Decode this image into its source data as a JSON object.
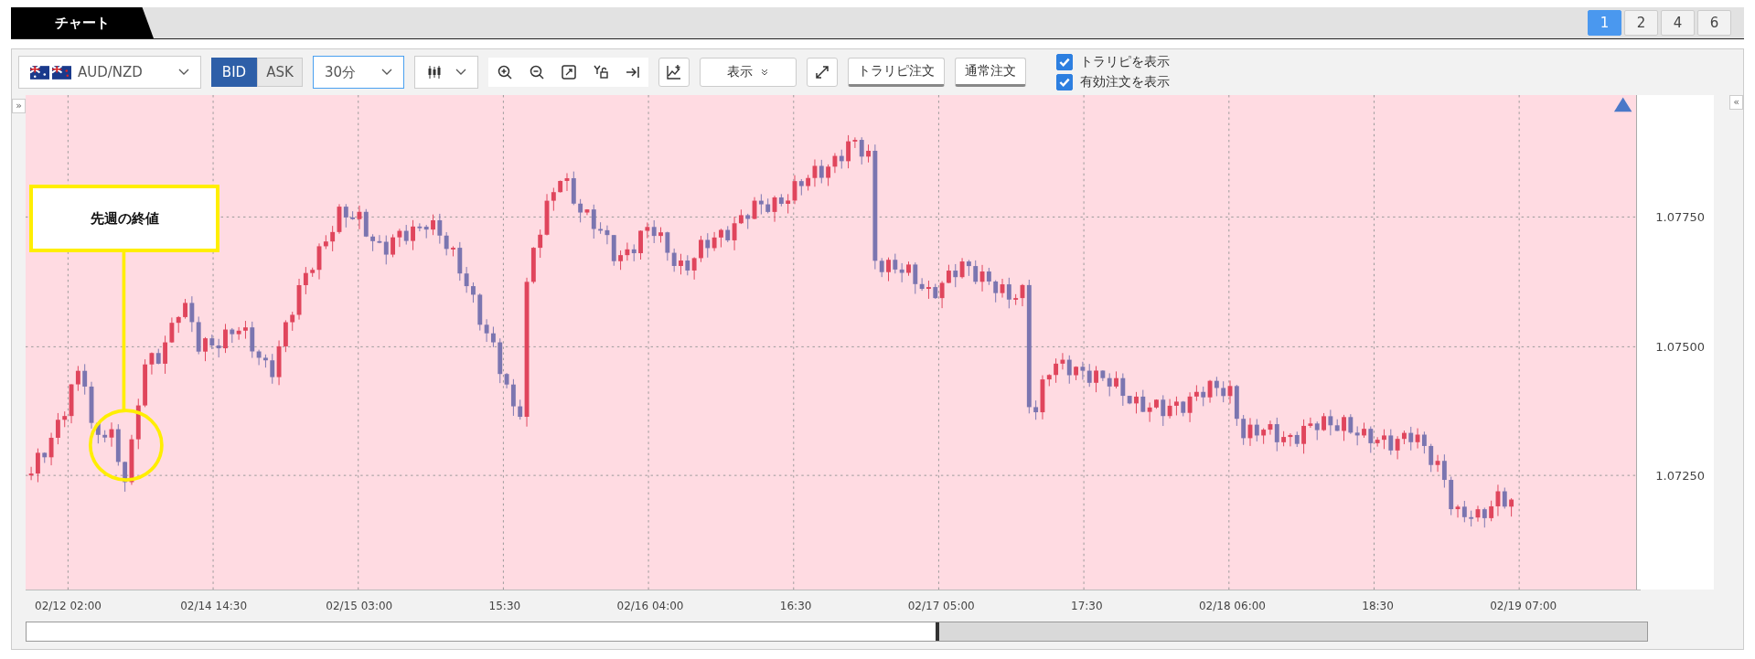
{
  "tabs": [
    {
      "label": "チャート",
      "selected": true
    }
  ],
  "layout_buttons": [
    {
      "label": "1",
      "selected": true
    },
    {
      "label": "2",
      "selected": false
    },
    {
      "label": "4",
      "selected": false
    },
    {
      "label": "6",
      "selected": false
    }
  ],
  "toolbar": {
    "pair": "AUD/NZD",
    "price_side": [
      {
        "label": "BID",
        "selected": true
      },
      {
        "label": "ASK",
        "selected": false
      }
    ],
    "timeframe": "30分",
    "display_menu": "表示",
    "order_buttons": [
      "トラリピ注文",
      "通常注文"
    ],
    "options": [
      {
        "label": "トラリピを表示",
        "checked": true
      },
      {
        "label": "有効注文を表示",
        "checked": true
      }
    ]
  },
  "chart": {
    "collapse_left": "»",
    "collapse_right": "«",
    "annotation": "先週の終値",
    "y_axis_labels": [
      "1.07750",
      "1.07500",
      "1.07250"
    ],
    "x_axis_labels": [
      "02/12 02:00",
      "02/14 14:30",
      "02/15 03:00",
      "15:30",
      "02/16 04:00",
      "16:30",
      "02/17 05:00",
      "17:30",
      "02/18 06:00",
      "18:30",
      "02/19 07:00"
    ]
  }
}
